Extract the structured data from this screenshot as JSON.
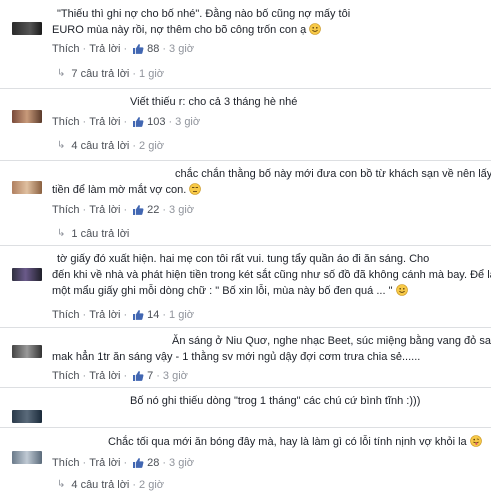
{
  "labels": {
    "like": "Thích",
    "reply": "Trả lời",
    "separator": "·"
  },
  "comments": [
    {
      "lines": [
        "\"Thiếu thì ghi nợ cho bố nhé\". Đằng nào bố cũng nợ mấy tôi",
        "EURO mùa này rồi, nợ thêm cho bõ công trốn con ạ"
      ],
      "emoji": "smile",
      "likes": "88",
      "time": "3 giờ",
      "replies": "7 câu trả lời",
      "replies_time": "1 giờ"
    },
    {
      "lines": [
        "Viết thiếu r: cho cả 3 tháng hè nhé"
      ],
      "likes": "103",
      "time": "3 giờ",
      "replies": "4 câu trả lời",
      "replies_time": "2 giờ"
    },
    {
      "lines": [
        "chắc chắn thằng bố này mới đưa con bồ từ khách sạn về nên lấy",
        "tiền để làm mờ mắt vợ con."
      ],
      "emoji": "unamused",
      "likes": "22",
      "time": "3 giờ",
      "replies": "1 câu trả lời"
    },
    {
      "lines": [
        "tờ giấy đó xuất hiện. hai mẹ con tôi rất vui. tung tẩy quần áo đi ăn sáng. Cho",
        "đến khi về nhà và phát hiện tiền trong két sắt cũng như số đồ đã không cánh mà bay. Để lại",
        "một mẩu giấy ghi mỗi dòng chữ : \" Bố xin lỗi, mùa này bố đen quá ... \""
      ],
      "emoji": "smile",
      "likes": "14",
      "time": "1 giờ"
    },
    {
      "lines": [
        "Ăn sáng ở Niu Quơ, nghe nhạc Beet, súc miệng bằng vang đỏ sao",
        "mak hẳn 1tr ăn sáng vậy - 1 thằng sv mới ngủ dậy đợi cơm trưa chia sẻ......"
      ],
      "likes": "7",
      "time": "3 giờ"
    },
    {
      "lines": [
        "Bố nó ghi thiếu dòng \"trog 1 tháng\" các chú cứ bình tĩnh :)))"
      ]
    },
    {
      "lines": [
        "Chắc tối qua mới ăn bóng đây mà, hay là làm gì có lỗi tính nịnh vợ khỏi la"
      ],
      "emoji": "tongue",
      "likes": "28",
      "time": "3 giờ",
      "replies": "4 câu trả lời",
      "replies_time": "2 giờ"
    }
  ],
  "colors": {
    "link": "#4b4f56",
    "meta": "#90949c",
    "like_icon": "#4267b2",
    "emoji": "#f7c948"
  }
}
